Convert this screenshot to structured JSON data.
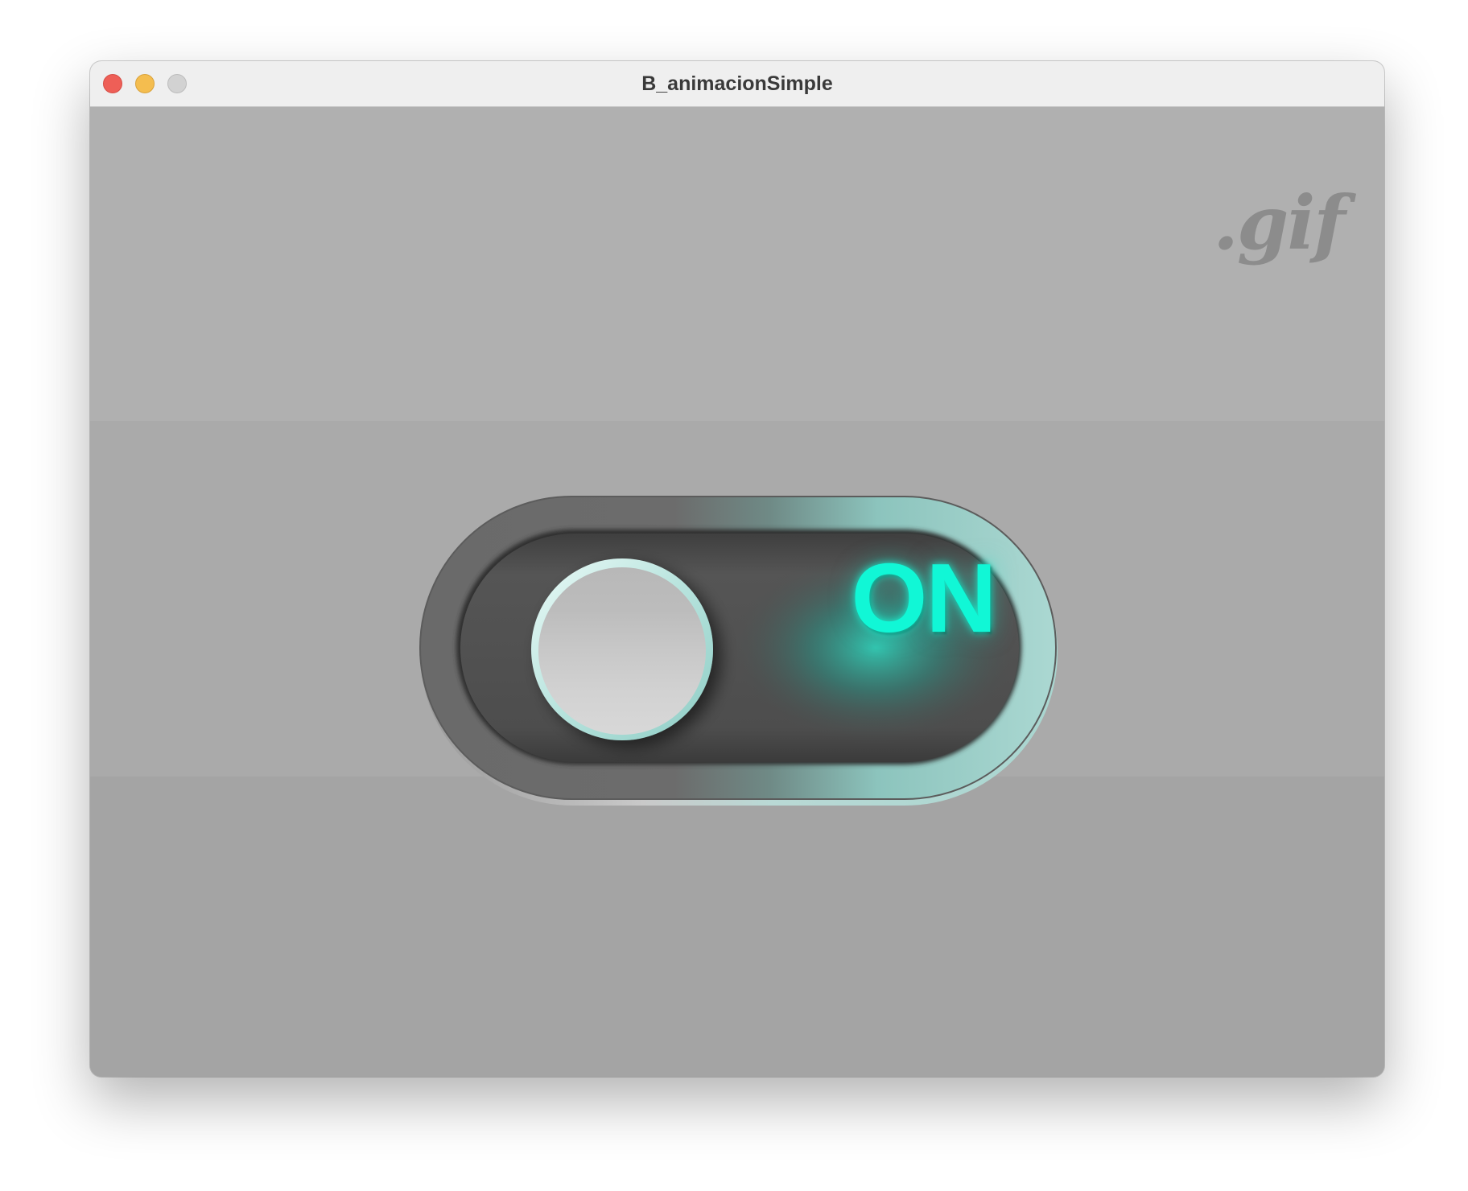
{
  "window": {
    "title": "B_animacionSimple",
    "controls": {
      "close": "close-button",
      "minimize": "minimize-button",
      "zoom": "zoom-button"
    }
  },
  "canvas": {
    "badge": ".gif",
    "toggle": {
      "state_label": "ON",
      "is_on": true,
      "accent_color": "#11f7d6"
    }
  }
}
